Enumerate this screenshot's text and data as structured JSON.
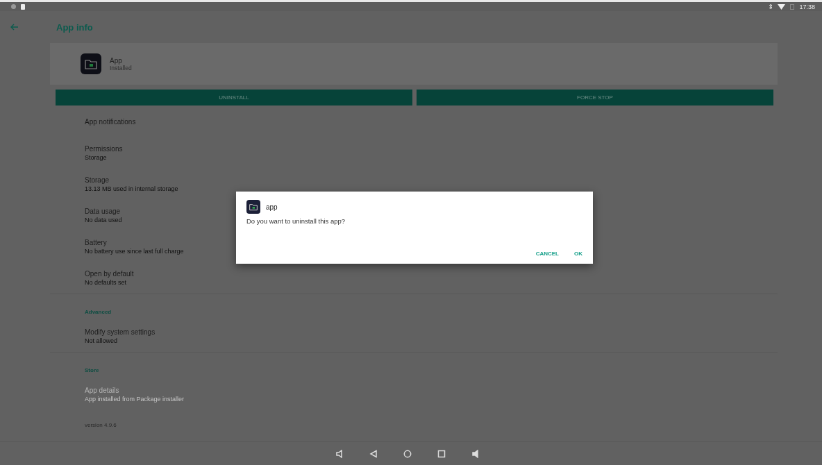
{
  "status_bar": {
    "time": "17:38"
  },
  "app_bar": {
    "title": "App info"
  },
  "app_header": {
    "name": "App",
    "status": "Installed"
  },
  "buttons": [
    {
      "label": "UNINSTALL"
    },
    {
      "label": "FORCE STOP"
    }
  ],
  "items": [
    {
      "kind": "item",
      "title": "App notifications",
      "disabled": false
    },
    {
      "kind": "item",
      "title": "Permissions",
      "summary": "Storage",
      "disabled": false
    },
    {
      "kind": "item",
      "title": "Storage",
      "summary": "13.13 MB used in internal storage",
      "disabled": false
    },
    {
      "kind": "item",
      "title": "Data usage",
      "summary": "No data used",
      "disabled": false
    },
    {
      "kind": "item",
      "title": "Battery",
      "summary": "No battery use since last full charge",
      "disabled": false
    },
    {
      "kind": "item",
      "title": "Open by default",
      "summary": "No defaults set",
      "disabled": false
    },
    {
      "kind": "header",
      "title": "Advanced"
    },
    {
      "kind": "item",
      "title": "Modify system settings",
      "summary": "Not allowed",
      "disabled": false
    },
    {
      "kind": "header",
      "title": "Store"
    },
    {
      "kind": "item",
      "title": "App details",
      "summary": "App installed from Package installer",
      "disabled": true
    },
    {
      "kind": "footer",
      "title": "version 4.9.6"
    }
  ],
  "dialog": {
    "app_name": "app",
    "message": "Do you want to uninstall this app?",
    "actions": [
      "CANCEL",
      "OK"
    ]
  }
}
